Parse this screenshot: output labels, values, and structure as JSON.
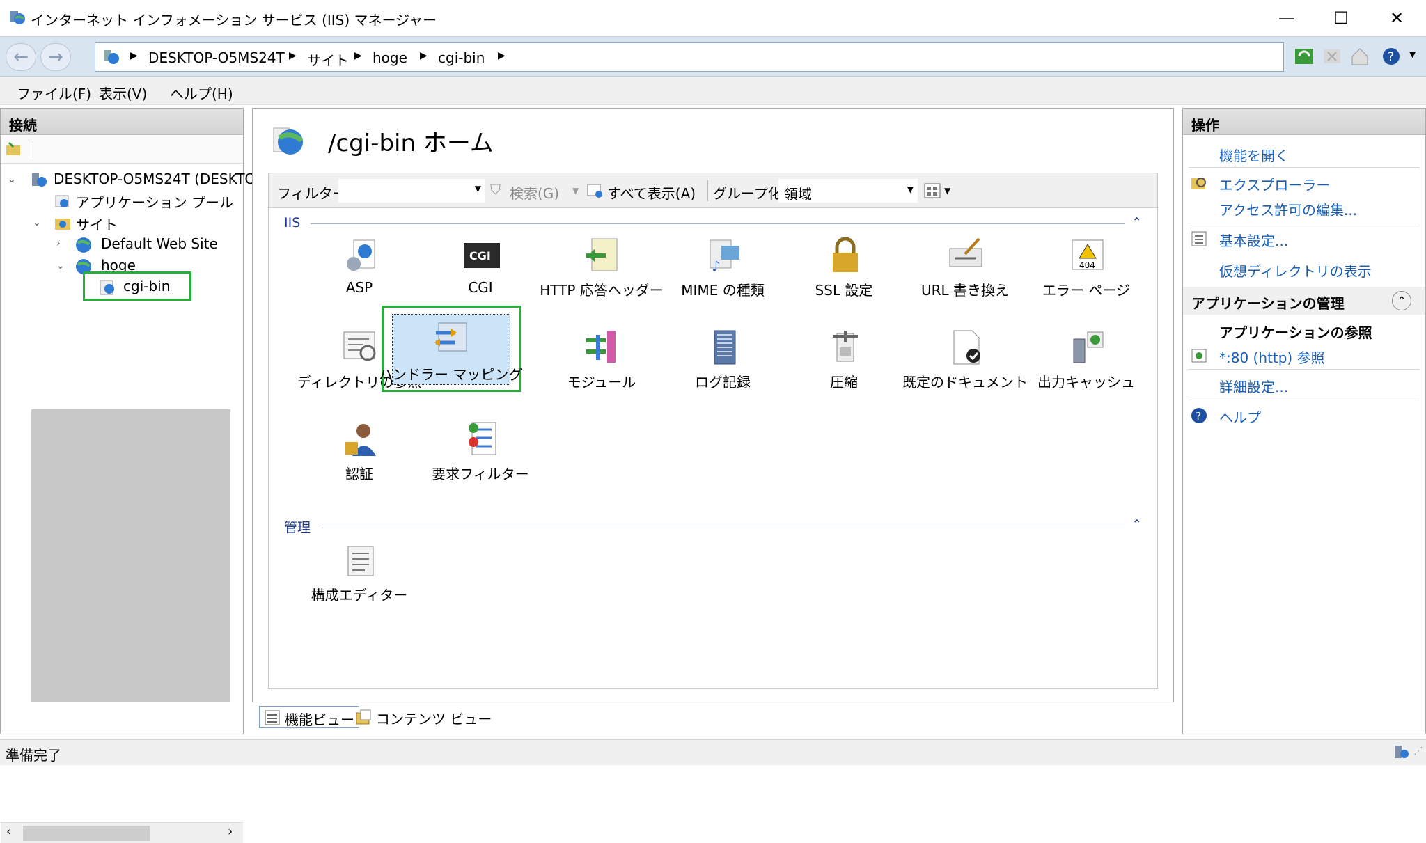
{
  "window": {
    "title": "インターネット インフォメーション サービス (IIS) マネージャー",
    "minimize": "—",
    "maximize": "☐",
    "close": "✕"
  },
  "address": {
    "crumbs": [
      "DESKTOP-O5MS24T",
      "サイト",
      "hoge",
      "cgi-bin"
    ]
  },
  "menu": {
    "file": "ファイル(F)",
    "view": "表示(V)",
    "help": "ヘルプ(H)"
  },
  "connections": {
    "header": "接続",
    "tree": {
      "server": "DESKTOP-O5MS24T (DESKTOI",
      "app_pools": "アプリケーション プール",
      "sites": "サイト",
      "default_site": "Default Web Site",
      "hoge": "hoge",
      "cgi_bin": "cgi-bin"
    }
  },
  "center": {
    "title": "/cgi-bin ホーム",
    "filter_label": "フィルター:",
    "filter_value": "",
    "search_label": "検索(G)",
    "show_all_label": "すべて表示(A)",
    "group_by_label": "グループ化:",
    "group_by_value": "領域",
    "groups": [
      {
        "name": "IIS",
        "features": [
          {
            "label": "ASP",
            "icon": "asp-icon"
          },
          {
            "label": "CGI",
            "icon": "cgi-icon"
          },
          {
            "label": "HTTP 応答ヘッダー",
            "icon": "http-response-headers-icon"
          },
          {
            "label": "MIME の種類",
            "icon": "mime-types-icon"
          },
          {
            "label": "SSL 設定",
            "icon": "ssl-lock-icon"
          },
          {
            "label": "URL 書き換え",
            "icon": "url-rewrite-icon"
          },
          {
            "label": "エラー ページ",
            "icon": "error-page-icon"
          },
          {
            "label": "ディレクトリの参照",
            "icon": "directory-browsing-icon"
          },
          {
            "label": "ハンドラー マッピング",
            "icon": "handler-mappings-icon"
          },
          {
            "label": "モジュール",
            "icon": "modules-icon"
          },
          {
            "label": "ログ記録",
            "icon": "logging-icon"
          },
          {
            "label": "圧縮",
            "icon": "compression-icon"
          },
          {
            "label": "既定のドキュメント",
            "icon": "default-document-icon"
          },
          {
            "label": "出力キャッシュ",
            "icon": "output-cache-icon"
          },
          {
            "label": "認証",
            "icon": "authentication-icon"
          },
          {
            "label": "要求フィルター",
            "icon": "request-filtering-icon"
          }
        ]
      },
      {
        "name": "管理",
        "features": [
          {
            "label": "構成エディター",
            "icon": "configuration-editor-icon"
          }
        ]
      }
    ],
    "tabs": {
      "features_view": "機能ビュー",
      "content_view": "コンテンツ ビュー"
    }
  },
  "actions": {
    "header": "操作",
    "open_feature": "機能を開く",
    "explore": "エクスプローラー",
    "edit_permissions": "アクセス許可の編集...",
    "basic_settings": "基本設定...",
    "view_virtual_dirs": "仮想ディレクトリの表示",
    "manage_app_header": "アプリケーションの管理",
    "browse_app_header": "アプリケーションの参照",
    "browse_80": "*:80 (http) 参照",
    "advanced_settings": "詳細設定...",
    "help": "ヘルプ"
  },
  "status": {
    "text": "準備完了"
  },
  "colors": {
    "highlight_box": "#27ae3a",
    "link": "#1a5fb4",
    "selected_bg": "#cce4f7"
  }
}
